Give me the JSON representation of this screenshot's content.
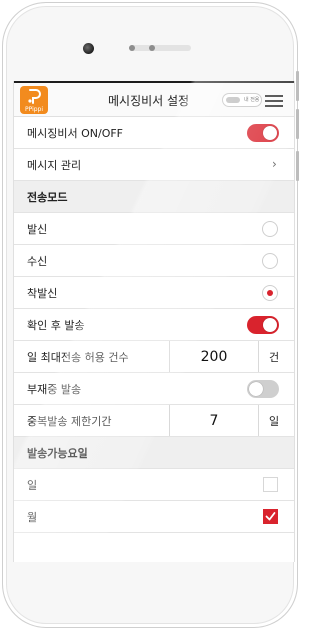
{
  "app": {
    "logo_text": "PPippi",
    "title": "메시징비서 설정",
    "status_pill_text": "내 전용",
    "accent_color": "#d9232d",
    "logo_color": "#f28b1e"
  },
  "settings": {
    "messaging_onoff": {
      "label": "메시징비서 ON/OFF",
      "on": true
    },
    "message_manage": {
      "label": "메시지 관리",
      "chevron": "›"
    }
  },
  "send_mode": {
    "header": "전송모드",
    "options": [
      {
        "label": "발신",
        "selected": false
      },
      {
        "label": "수신",
        "selected": false
      },
      {
        "label": "착발신",
        "selected": true
      }
    ]
  },
  "send_after_confirm": {
    "label": "확인 후 발송",
    "on": true
  },
  "daily_max": {
    "label": "일 최대전송 허용 건수",
    "value": "200",
    "unit": "건"
  },
  "send_when_absent": {
    "label": "부재중 발송",
    "on": false
  },
  "duplicate_limit": {
    "label": "중복발송 제한기간",
    "value": "7",
    "unit": "일"
  },
  "send_days": {
    "header": "발송가능요일",
    "days": [
      {
        "label": "일",
        "checked": false
      },
      {
        "label": "월",
        "checked": true
      }
    ]
  }
}
